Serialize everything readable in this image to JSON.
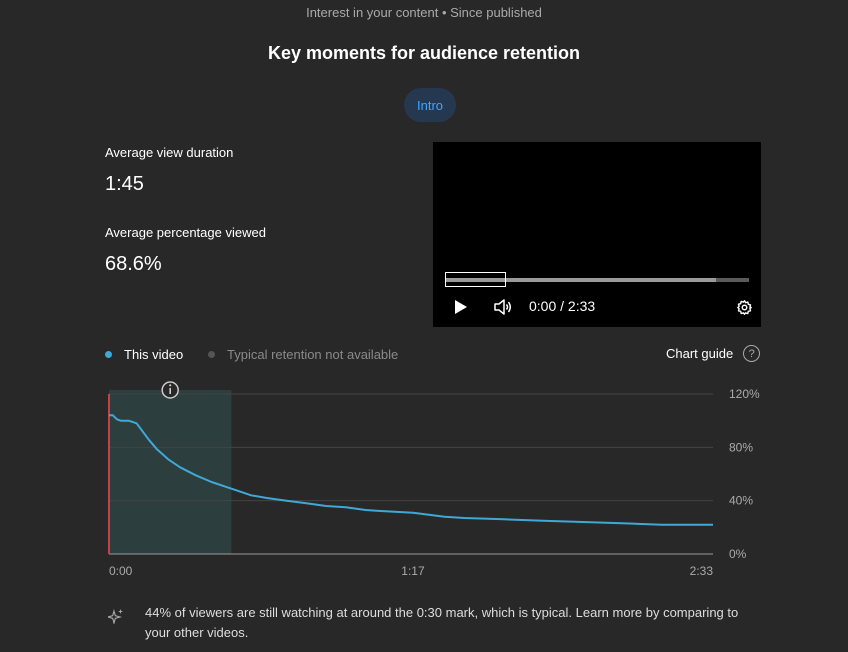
{
  "header": {
    "subtitle": "Interest in your content • Since published",
    "title": "Key moments for audience retention"
  },
  "chip": {
    "label": "Intro"
  },
  "metrics": [
    {
      "label": "Average view duration",
      "value": "1:45"
    },
    {
      "label": "Average percentage viewed",
      "value": "68.6%"
    }
  ],
  "player": {
    "time_readout": "0:00 / 2:33",
    "buffered_fraction": 0.89
  },
  "legend": {
    "this_video": "This video",
    "typical": "Typical retention not available"
  },
  "chart_guide": {
    "label": "Chart guide",
    "help_glyph": "?"
  },
  "insight": {
    "text": "44% of viewers are still watching at around the 0:30 mark, which is typical. Learn more by comparing to your other videos."
  },
  "colors": {
    "series": "#3fa9d6",
    "cursor": "#c0434a",
    "highlight": "#2d3e3f",
    "accent": "#3ea6ff",
    "chip_bg": "#263850"
  },
  "chart_data": {
    "type": "line",
    "title": "",
    "xlabel": "",
    "ylabel": "",
    "x_unit": "seconds",
    "x_tick_labels": [
      "0:00",
      "1:17",
      "2:33"
    ],
    "x_ticks": [
      0,
      77,
      153
    ],
    "y_tick_labels": [
      "0%",
      "40%",
      "80%",
      "120%"
    ],
    "y_ticks": [
      0,
      40,
      80,
      120
    ],
    "xlim": [
      0,
      153
    ],
    "ylim": [
      0,
      120
    ],
    "grid": true,
    "highlight_range": [
      0,
      31
    ],
    "highlight_label": "Intro",
    "cursor_x": 0,
    "series": [
      {
        "name": "This video",
        "x": [
          0,
          1,
          2,
          3,
          5,
          7,
          8,
          10,
          12,
          15,
          18,
          22,
          26,
          30,
          33,
          36,
          40,
          45,
          50,
          55,
          60,
          65,
          70,
          77,
          85,
          90,
          100,
          110,
          120,
          130,
          140,
          145,
          150,
          153
        ],
        "values": [
          104,
          104,
          101,
          100,
          100,
          98,
          94,
          86,
          79,
          71,
          65,
          59,
          54,
          50,
          47,
          44,
          42,
          40,
          38,
          36,
          35,
          33,
          32,
          31,
          28,
          27,
          26,
          25,
          24,
          23,
          22,
          22,
          22,
          22
        ]
      }
    ]
  }
}
